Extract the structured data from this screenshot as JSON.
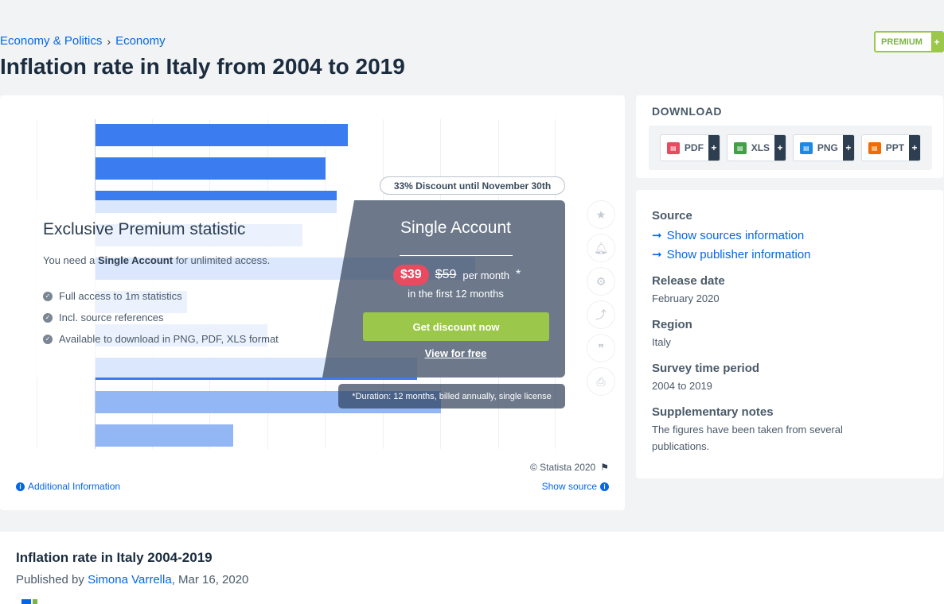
{
  "header": {
    "breadcrumb": [
      "Economy & Politics",
      "Economy"
    ],
    "breadcrumb_separator": "›",
    "title": "Inflation rate in Italy from 2004 to 2019",
    "premium_badge": "PREMIUM",
    "premium_plus": "+"
  },
  "chart_data": {
    "type": "bar",
    "orientation": "horizontal",
    "note": "values obscured by paywall overlay",
    "bar_count": 13,
    "accent_color": "#3b7df0"
  },
  "overlay": {
    "heading": "Exclusive Premium statistic",
    "sub_prefix": "You need a ",
    "sub_bold": "Single Account",
    "sub_suffix": " for unlimited access.",
    "features": [
      "Full access to 1m statistics",
      "Incl. source references",
      "Available to download in PNG, PDF, XLS format"
    ],
    "discount_pill": "33% Discount until November 30th",
    "account_title": "Single Account",
    "price_new": "$39",
    "price_old": "$59",
    "price_per": "per month",
    "price_star": "*",
    "price_first": "in the first 12 months",
    "cta_discount": "Get discount now",
    "cta_free": "View for free",
    "duration": "*Duration: 12 months, billed annually, single license"
  },
  "side_icons": [
    "star-icon",
    "bell-icon",
    "gear-icon",
    "share-icon",
    "quote-icon",
    "print-icon"
  ],
  "footer_chart": {
    "copyright": "© Statista 2020",
    "additional_info": "Additional Information",
    "show_source": "Show source"
  },
  "download": {
    "title": "DOWNLOAD",
    "buttons": [
      {
        "label": "PDF",
        "color": "#e84a5f"
      },
      {
        "label": "XLS",
        "color": "#43a047"
      },
      {
        "label": "PNG",
        "color": "#1e88e5"
      },
      {
        "label": "PPT",
        "color": "#ef6c00"
      }
    ],
    "plus": "+"
  },
  "source_panel": {
    "source_heading": "Source",
    "show_sources": "Show sources information",
    "show_publisher": "Show publisher information",
    "release_heading": "Release date",
    "release_value": "February 2020",
    "region_heading": "Region",
    "region_value": "Italy",
    "survey_heading": "Survey time period",
    "survey_value": "2004 to 2019",
    "notes_heading": "Supplementary notes",
    "notes_value": "The figures have been taken from several publications."
  },
  "bottom": {
    "title": "Inflation rate in Italy 2004-2019",
    "published_by": "Published by ",
    "author": "Simona Varrella",
    "date": ", Mar 16, 2020"
  }
}
